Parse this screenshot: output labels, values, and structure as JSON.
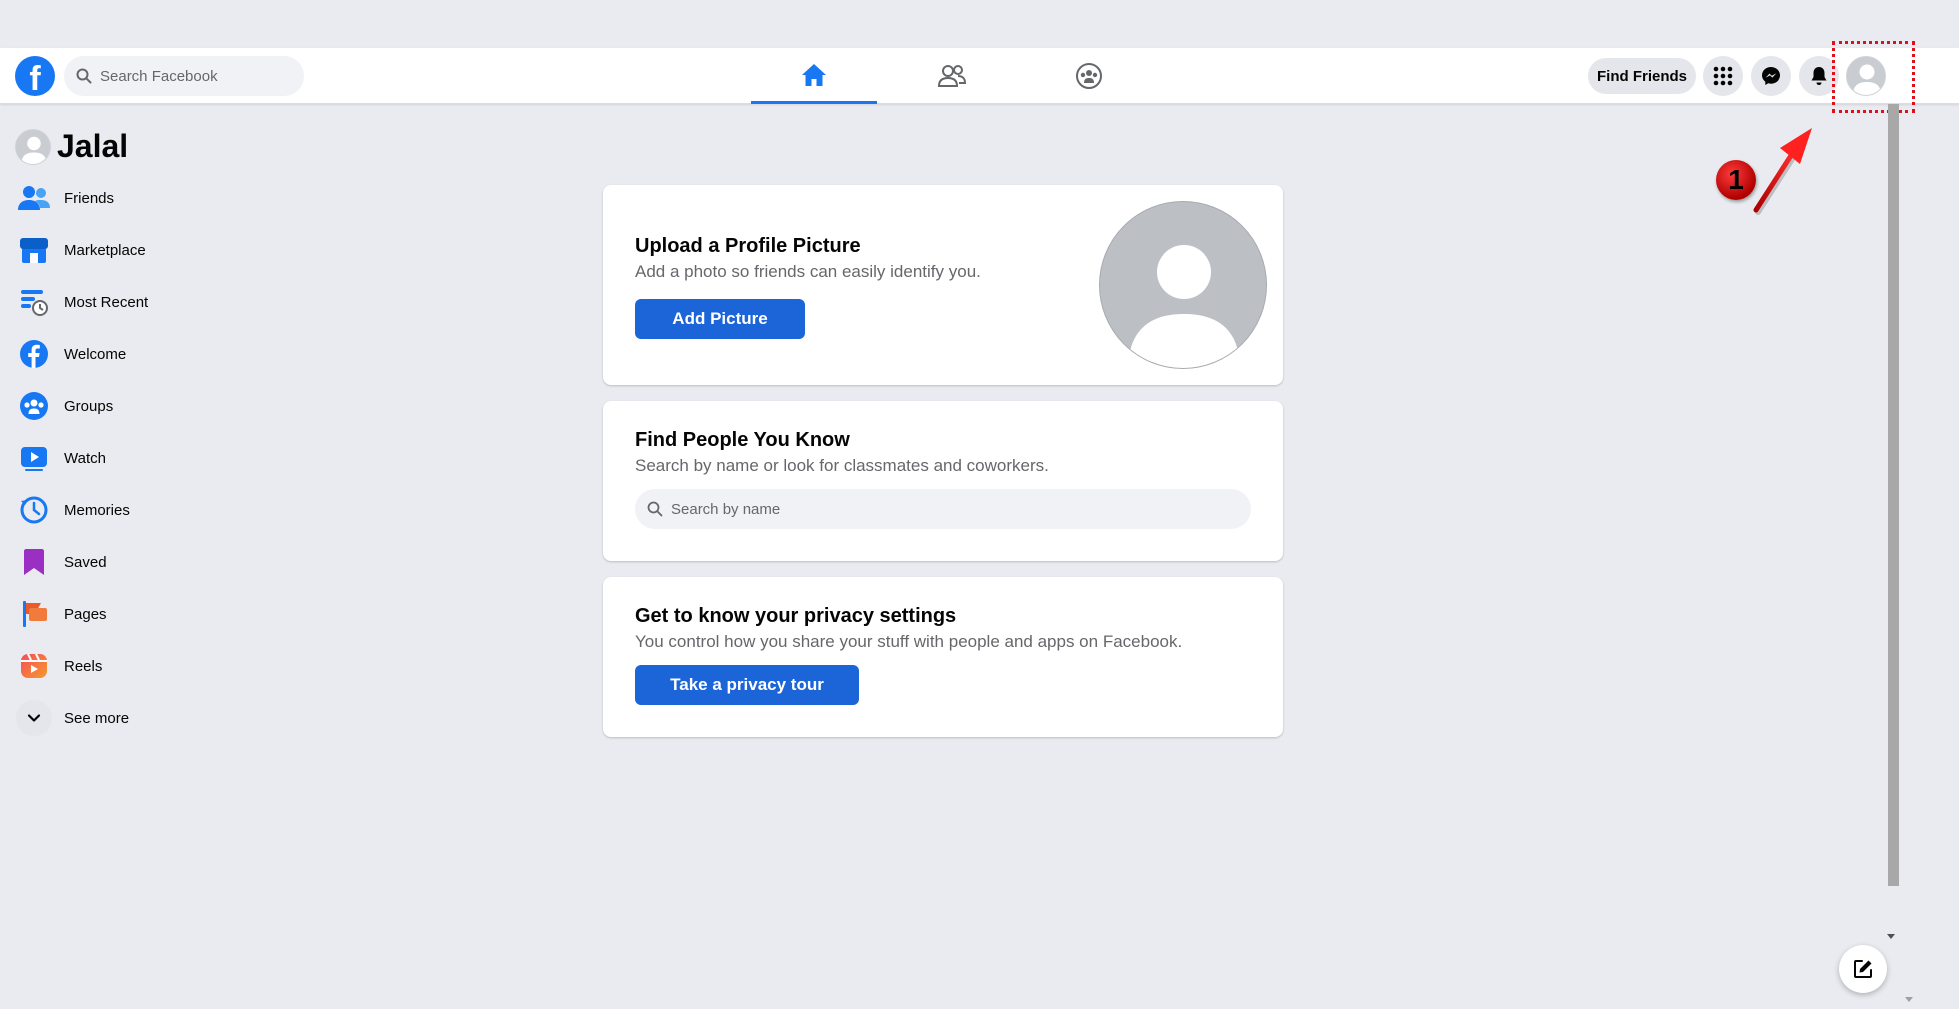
{
  "topbar": {
    "logo_letter": "f",
    "search_placeholder": "Search Facebook",
    "find_friends_label": "Find Friends",
    "tabs": [
      {
        "name": "home",
        "icon": "home-icon",
        "active": true
      },
      {
        "name": "friends",
        "icon": "friends-icon",
        "active": false
      },
      {
        "name": "groups",
        "icon": "groups-icon",
        "active": false
      }
    ],
    "icons": [
      "menu-grid-icon",
      "messenger-icon",
      "bell-icon",
      "account-avatar"
    ]
  },
  "annotation": {
    "step_number": "1"
  },
  "sidebar": {
    "profile_name": "Jalal",
    "items": [
      {
        "label": "Friends",
        "icon": "friends-icon"
      },
      {
        "label": "Marketplace",
        "icon": "marketplace-icon"
      },
      {
        "label": "Most Recent",
        "icon": "most-recent-icon"
      },
      {
        "label": "Welcome",
        "icon": "facebook-icon"
      },
      {
        "label": "Groups",
        "icon": "groups-icon"
      },
      {
        "label": "Watch",
        "icon": "watch-icon"
      },
      {
        "label": "Memories",
        "icon": "memories-icon"
      },
      {
        "label": "Saved",
        "icon": "saved-icon"
      },
      {
        "label": "Pages",
        "icon": "pages-icon"
      },
      {
        "label": "Reels",
        "icon": "reels-icon"
      },
      {
        "label": "See more",
        "icon": "chevron-down-icon"
      }
    ]
  },
  "cards": {
    "upload": {
      "title": "Upload a Profile Picture",
      "subtitle": "Add a photo so friends can easily identify you.",
      "button": "Add Picture"
    },
    "find_people": {
      "title": "Find People You Know",
      "subtitle": "Search by name or look for classmates and coworkers.",
      "search_placeholder": "Search by name"
    },
    "privacy": {
      "title": "Get to know your privacy settings",
      "subtitle": "You control how you share your stuff with people and apps on Facebook.",
      "button": "Take a privacy tour"
    }
  },
  "colors": {
    "accent": "#1877f2",
    "button_blue": "#1b65d8",
    "background": "#e9ebf0",
    "highlight": "#e0101b"
  }
}
